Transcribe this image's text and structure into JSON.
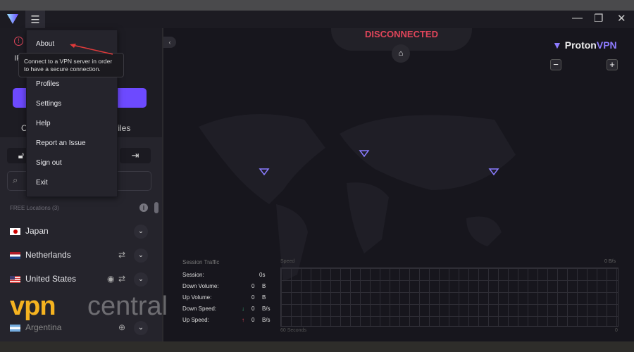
{
  "app": {
    "name": "ProtonVPN",
    "brand_first": "Proton",
    "brand_second": "VPN",
    "accent": "#6d4aff",
    "status_color": "#e0455a"
  },
  "window_controls": {
    "minimize": "—",
    "restore": "❐",
    "close": "✕"
  },
  "menu": {
    "items": [
      "About",
      "Profiles",
      "Settings",
      "Help",
      "Report an Issue",
      "Sign out",
      "Exit"
    ]
  },
  "tooltip": "Connect to a VPN server in order to have a secure connection.",
  "sidebar": {
    "ip_label": "IP",
    "tab_countries": "C",
    "tab_profiles": "files",
    "section_label": "FREE Locations (3)",
    "countries": [
      {
        "name": "Japan",
        "flag": "jp"
      },
      {
        "name": "Netherlands",
        "flag": "nl",
        "icons": [
          "p2p-icon"
        ]
      },
      {
        "name": "United States",
        "flag": "us",
        "icons": [
          "tor-icon",
          "p2p-icon"
        ]
      },
      {
        "name": "Argentina",
        "flag": "ar",
        "icons": [
          "globe-icon"
        ]
      }
    ]
  },
  "main": {
    "status": "DISCONNECTED"
  },
  "traffic": {
    "title": "Session Traffic",
    "rows": [
      {
        "label": "Session:",
        "value": "0s",
        "unit": ""
      },
      {
        "label": "Down Volume:",
        "value": "0",
        "unit": "B"
      },
      {
        "label": "Up Volume:",
        "value": "0",
        "unit": "B"
      },
      {
        "label": "Down Speed:",
        "value": "0",
        "unit": "B/s",
        "arrow": "↓"
      },
      {
        "label": "Up Speed:",
        "value": "0",
        "unit": "B/s",
        "arrow": "↑"
      }
    ],
    "speed_label": "Speed",
    "speed_max": "0 B/s",
    "x_start": "60 Seconds",
    "x_end": "0"
  },
  "watermark": {
    "text_a": "vpn",
    "text_b": "central"
  }
}
